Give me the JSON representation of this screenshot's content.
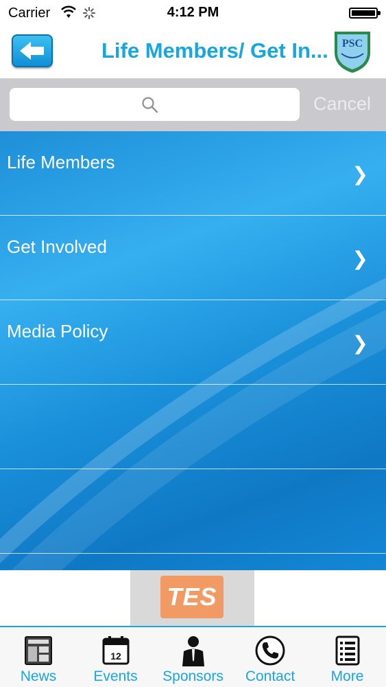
{
  "status_bar": {
    "carrier": "Carrier",
    "time": "4:12 PM"
  },
  "header": {
    "title": "Life Members/ Get In...",
    "back_icon": "arrow-left-icon",
    "logo_text": "PSC"
  },
  "search": {
    "placeholder": "",
    "cancel_label": "Cancel"
  },
  "list": {
    "items": [
      {
        "label": "Life Members",
        "chevron": "❯"
      },
      {
        "label": "Get Involved",
        "chevron": "❯"
      },
      {
        "label": "Media Policy",
        "chevron": "❯"
      }
    ]
  },
  "banner": {
    "ad_text": "TES"
  },
  "tabs": [
    {
      "label": "News",
      "icon": "newspaper-icon"
    },
    {
      "label": "Events",
      "icon": "calendar-icon"
    },
    {
      "label": "Sponsors",
      "icon": "person-icon"
    },
    {
      "label": "Contact",
      "icon": "phone-icon"
    },
    {
      "label": "More",
      "icon": "list-icon"
    }
  ],
  "colors": {
    "accent": "#1ba5e0",
    "list_bg": "#1a90da",
    "search_bg": "#c9c9ce"
  }
}
